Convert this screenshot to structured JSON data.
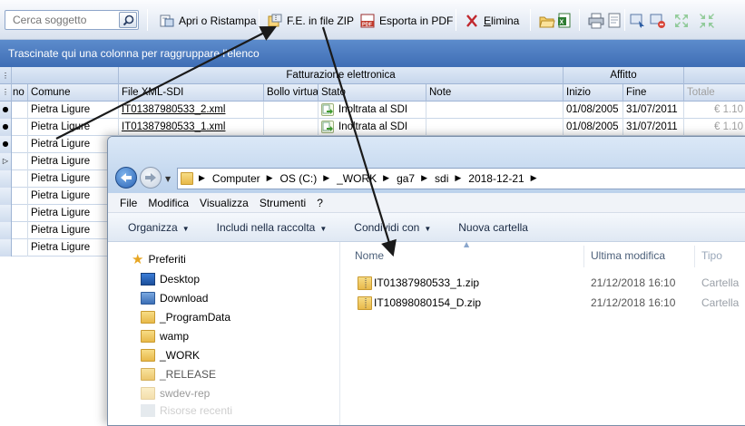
{
  "toolbar": {
    "search_placeholder": "Cerca soggetto",
    "open_print": "Apri o Ristampa",
    "zip": "F.E. in file ZIP",
    "pdf": "Esporta in PDF",
    "delete": "Elimina",
    "delete_accel": "E",
    "delete_rest": "limina"
  },
  "group_panel": "Trascinate qui una colonna per raggruppare l'elenco",
  "grid": {
    "bands": {
      "fatturazione": "Fatturazione elettronica",
      "affitto": "Affitto"
    },
    "columns": {
      "no": "no",
      "comune": "Comune",
      "file": "File XML-SDI",
      "bollo": "Bollo virtual",
      "stato": "Stato",
      "note": "Note",
      "inizio": "Inizio",
      "fine": "Fine",
      "totale": "Totale"
    },
    "rows": [
      {
        "comune": "Pietra Ligure",
        "file": "IT01387980533_2.xml",
        "stato": "Inoltrata al SDI",
        "inizio": "01/08/2005",
        "fine": "31/07/2011",
        "totale": "€ 1.10"
      },
      {
        "comune": "Pietra Ligure",
        "file": "IT01387980533_1.xml",
        "stato": "Inoltrata al SDI",
        "inizio": "01/08/2005",
        "fine": "31/07/2011",
        "totale": "€ 1.10"
      },
      {
        "comune": "Pietra Ligure"
      },
      {
        "comune": "Pietra Ligure"
      },
      {
        "comune": "Pietra Ligure"
      },
      {
        "comune": "Pietra Ligure"
      },
      {
        "comune": "Pietra Ligure"
      },
      {
        "comune": "Pietra Ligure"
      },
      {
        "comune": "Pietra Ligure"
      }
    ]
  },
  "explorer": {
    "breadcrumb": [
      "Computer",
      "OS (C:)",
      "_WORK",
      "ga7",
      "sdi",
      "2018-12-21"
    ],
    "menu": [
      "File",
      "Modifica",
      "Visualizza",
      "Strumenti",
      "?"
    ],
    "commands": [
      "Organizza",
      "Includi nella raccolta",
      "Condividi con",
      "Nuova cartella"
    ],
    "favorites_label": "Preferiti",
    "nav_items": [
      "Desktop",
      "Download",
      "_ProgramData",
      "wamp",
      "_WORK",
      "_RELEASE",
      "swdev-rep",
      "Risorse recenti"
    ],
    "columns": {
      "name": "Nome",
      "modified": "Ultima modifica",
      "type": "Tipo"
    },
    "files": [
      {
        "name": "IT01387980533_1.zip",
        "modified": "21/12/2018 16:10",
        "type": "Cartella"
      },
      {
        "name": "IT10898080154_D.zip",
        "modified": "21/12/2018 16:10",
        "type": "Cartella"
      }
    ]
  },
  "colors": {
    "group_bar": "#4a7bc0",
    "header": "#d6e2f2",
    "arrow": "#1a1a1a"
  }
}
